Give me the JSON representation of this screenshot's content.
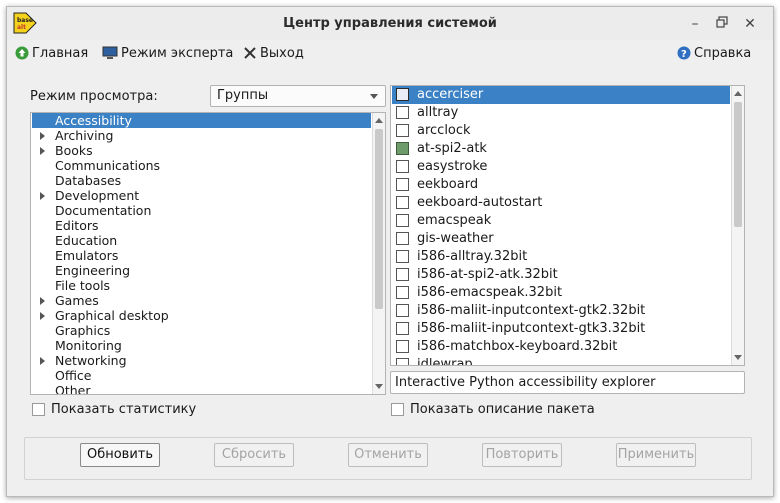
{
  "window": {
    "title": "Центр управления системой",
    "logo_text": "base alt"
  },
  "menu": {
    "home_label": "Главная",
    "expert_label": "Режим эксперта",
    "exit_label": "Выход",
    "help_label": "Справка"
  },
  "view_mode": {
    "label": "Режим просмотра:",
    "selected": "Группы"
  },
  "groups": [
    {
      "label": "Accessibility",
      "expandable": false,
      "selected": true
    },
    {
      "label": "Archiving",
      "expandable": true
    },
    {
      "label": "Books",
      "expandable": true
    },
    {
      "label": "Communications",
      "expandable": false
    },
    {
      "label": "Databases",
      "expandable": false
    },
    {
      "label": "Development",
      "expandable": true
    },
    {
      "label": "Documentation",
      "expandable": false
    },
    {
      "label": "Editors",
      "expandable": false
    },
    {
      "label": "Education",
      "expandable": false
    },
    {
      "label": "Emulators",
      "expandable": false
    },
    {
      "label": "Engineering",
      "expandable": false
    },
    {
      "label": "File tools",
      "expandable": false
    },
    {
      "label": "Games",
      "expandable": true
    },
    {
      "label": "Graphical desktop",
      "expandable": true
    },
    {
      "label": "Graphics",
      "expandable": false
    },
    {
      "label": "Monitoring",
      "expandable": false
    },
    {
      "label": "Networking",
      "expandable": true
    },
    {
      "label": "Office",
      "expandable": false
    },
    {
      "label": "Other",
      "expandable": false
    }
  ],
  "packages": [
    {
      "name": "accerciser",
      "checked": false,
      "selected": true
    },
    {
      "name": "alltray",
      "checked": false
    },
    {
      "name": "arcclock",
      "checked": false
    },
    {
      "name": "at-spi2-atk",
      "checked": true
    },
    {
      "name": "easystroke",
      "checked": false
    },
    {
      "name": "eekboard",
      "checked": false
    },
    {
      "name": "eekboard-autostart",
      "checked": false
    },
    {
      "name": "emacspeak",
      "checked": false
    },
    {
      "name": "gis-weather",
      "checked": false
    },
    {
      "name": "i586-alltray.32bit",
      "checked": false
    },
    {
      "name": "i586-at-spi2-atk.32bit",
      "checked": false
    },
    {
      "name": "i586-emacspeak.32bit",
      "checked": false
    },
    {
      "name": "i586-maliit-inputcontext-gtk2.32bit",
      "checked": false
    },
    {
      "name": "i586-maliit-inputcontext-gtk3.32bit",
      "checked": false
    },
    {
      "name": "i586-matchbox-keyboard.32bit",
      "checked": false
    },
    {
      "name": "idlewrap",
      "checked": false
    }
  ],
  "package_description": "Interactive Python accessibility explorer",
  "show_stats_label": "Показать статистику",
  "show_desc_label": "Показать описание пакета",
  "buttons": {
    "refresh": "Обновить",
    "reset": "Сбросить",
    "cancel": "Отменить",
    "repeat": "Повторить",
    "apply": "Применить"
  },
  "colors": {
    "selection": "#3b81c5",
    "checked_box": "#6d9b6a"
  }
}
